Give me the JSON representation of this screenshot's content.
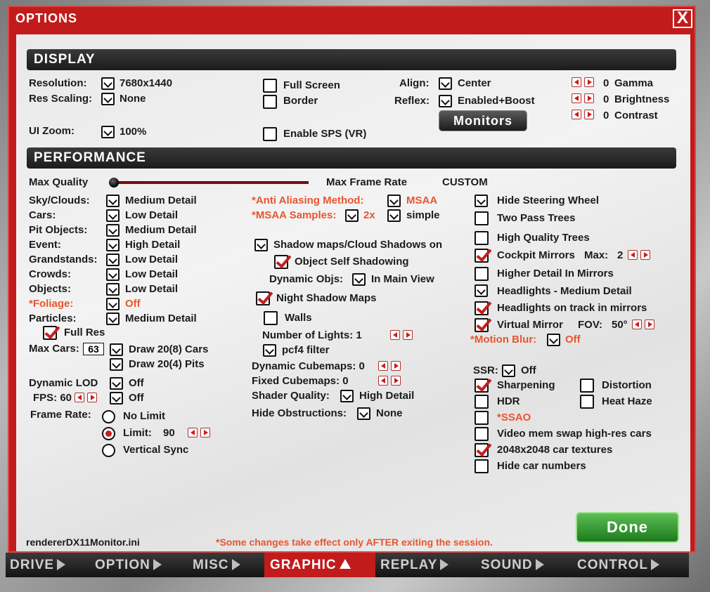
{
  "window": {
    "title": "OPTIONS",
    "close": "X"
  },
  "display": {
    "header": "DISPLAY",
    "resolution_label": "Resolution:",
    "resolution_value": "7680x1440",
    "res_scaling_label": "Res Scaling:",
    "res_scaling_value": "None",
    "ui_zoom_label": "UI Zoom:",
    "ui_zoom_value": "100%",
    "full_screen": "Full Screen",
    "border": "Border",
    "enable_sps": "Enable SPS (VR)",
    "align_label": "Align:",
    "align_value": "Center",
    "reflex_label": "Reflex:",
    "reflex_value": "Enabled+Boost",
    "monitors_button": "Monitors",
    "gamma_value": "0",
    "gamma_label": "Gamma",
    "brightness_value": "0",
    "brightness_label": "Brightness",
    "contrast_value": "0",
    "contrast_label": "Contrast"
  },
  "performance": {
    "header": "PERFORMANCE",
    "max_quality": "Max Quality",
    "max_frame_rate": "Max Frame Rate",
    "preset": "CUSTOM",
    "col1": [
      {
        "label": "Sky/Clouds:",
        "value": "Medium Detail"
      },
      {
        "label": "Cars:",
        "value": "Low Detail"
      },
      {
        "label": "Pit Objects:",
        "value": "Medium Detail"
      },
      {
        "label": "Event:",
        "value": "High Detail"
      },
      {
        "label": "Grandstands:",
        "value": "Low Detail"
      },
      {
        "label": "Crowds:",
        "value": "Low Detail"
      },
      {
        "label": "Objects:",
        "value": "Low Detail"
      },
      {
        "label": "*Foliage:",
        "value": "Off"
      },
      {
        "label": "Particles:",
        "value": "Medium Detail"
      }
    ],
    "full_res": "Full Res",
    "max_cars_label": "Max Cars:",
    "max_cars_value": "63",
    "draw_cars": "Draw 20(8) Cars",
    "draw_pits": "Draw 20(4) Pits",
    "dynamic_lod_label": "Dynamic LOD",
    "dynamic_lod_value": "Off",
    "fps_label": "FPS: 60",
    "fps_value": "Off",
    "frame_rate_label": "Frame Rate:",
    "no_limit": "No Limit",
    "limit_label": "Limit:",
    "limit_value": "90",
    "vertical_sync": "Vertical Sync",
    "aa_method_label": "*Anti Aliasing Method:",
    "aa_method_value": "MSAA",
    "msaa_samples_label": "*MSAA Samples:",
    "msaa_samples_value": "2x",
    "msaa_mode": "simple",
    "shadow_maps": "Shadow maps/Cloud Shadows on",
    "object_self_shadowing": "Object Self Shadowing",
    "dynamic_objs_label": "Dynamic Objs:",
    "dynamic_objs_value": "In Main View",
    "night_shadow_maps": "Night Shadow Maps",
    "walls": "Walls",
    "num_lights": "Number of Lights: 1",
    "pcf4": "pcf4 filter",
    "dynamic_cubemaps": "Dynamic Cubemaps: 0",
    "fixed_cubemaps": "Fixed Cubemaps: 0",
    "shader_quality_label": "Shader Quality:",
    "shader_quality_value": "High Detail",
    "hide_obstructions_label": "Hide Obstructions:",
    "hide_obstructions_value": "None",
    "hide_steering_wheel": "Hide Steering Wheel",
    "two_pass_trees": "Two Pass Trees",
    "high_quality_trees": "High Quality Trees",
    "cockpit_mirrors": "Cockpit Mirrors",
    "mirrors_max_label": "Max:",
    "mirrors_max_value": "2",
    "higher_detail_mirrors": "Higher Detail In Mirrors",
    "headlights_label": "Headlights - Medium Detail",
    "headlights_mirrors": "Headlights on track in mirrors",
    "virtual_mirror": "Virtual Mirror",
    "fov_label": "FOV:",
    "fov_value": "50°",
    "motion_blur_label": "*Motion Blur:",
    "motion_blur_value": "Off",
    "ssr_label": "SSR:",
    "ssr_value": "Off",
    "sharpening": "Sharpening",
    "distortion": "Distortion",
    "hdr": "HDR",
    "heat_haze": "Heat Haze",
    "ssao": "*SSAO",
    "video_mem_swap": "Video mem swap high-res cars",
    "car_textures": "2048x2048 car textures",
    "hide_car_numbers": "Hide car numbers"
  },
  "footer": {
    "ini_file": "rendererDX11Monitor.ini",
    "note": "*Some changes take effect only AFTER exiting the session.",
    "done": "Done"
  },
  "tabs": [
    "DRIVE",
    "OPTION",
    "MISC",
    "GRAPHIC",
    "REPLAY",
    "SOUND",
    "CONTROL"
  ]
}
